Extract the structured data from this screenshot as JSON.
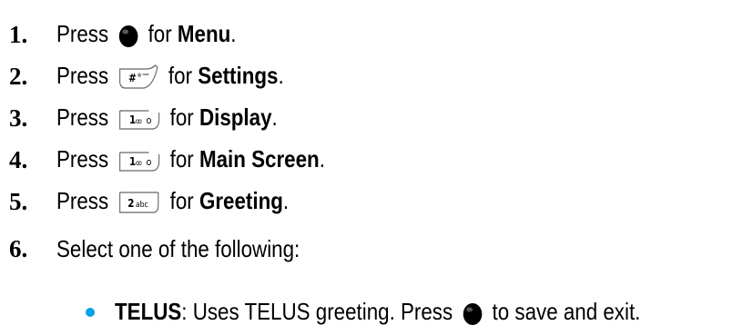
{
  "steps": [
    {
      "num": "1.",
      "press": "Press",
      "key_icon": "center-select-key-icon",
      "for": "for",
      "target": "Menu",
      "end": "."
    },
    {
      "num": "2.",
      "press": "Press",
      "key_icon": "pound-key-icon",
      "key_label": "#",
      "for": "for",
      "target": "Settings",
      "end": "."
    },
    {
      "num": "3.",
      "press": "Press",
      "key_icon": "key-1-icon",
      "key_label": "1",
      "for": "for",
      "target": "Display",
      "end": "."
    },
    {
      "num": "4.",
      "press": "Press",
      "key_icon": "key-1-icon",
      "key_label": "1",
      "for": "for",
      "target": "Main Screen",
      "end": "."
    },
    {
      "num": "5.",
      "press": "Press",
      "key_icon": "key-2abc-icon",
      "key_label": "2",
      "key_sub": "abc",
      "for": "for",
      "target": "Greeting",
      "end": "."
    },
    {
      "num": "6.",
      "text": "Select one of the following:"
    }
  ],
  "options": [
    {
      "term": "TELUS",
      "desc": ": Uses TELUS greeting. Press",
      "key_icon": "center-select-key-icon",
      "after": "to save and exit.",
      "bullet_color": "#00a3e6"
    }
  ]
}
